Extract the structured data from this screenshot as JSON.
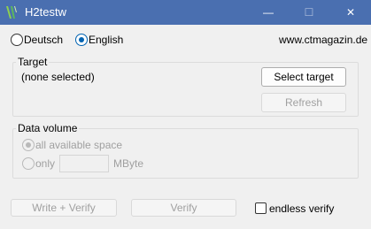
{
  "window": {
    "title": "H2testw",
    "minimize_glyph": "—",
    "maximize_glyph": "☐",
    "close_glyph": "✕",
    "titlebar_color": "#4a6fb0"
  },
  "language": {
    "deutsch_label": "Deutsch",
    "english_label": "English",
    "selected": "English"
  },
  "website": "www.ctmagazin.de",
  "target": {
    "title": "Target",
    "value": "(none selected)",
    "select_button": "Select target",
    "refresh_button": "Refresh"
  },
  "data_volume": {
    "title": "Data volume",
    "all_space_label": "all available space",
    "only_label": "only",
    "unit_label": "MByte",
    "amount_value": ""
  },
  "actions": {
    "write_verify_button": "Write + Verify",
    "verify_button": "Verify",
    "endless_verify_label": "endless verify",
    "endless_verify_checked": false
  },
  "accent_color": "#0063b1"
}
